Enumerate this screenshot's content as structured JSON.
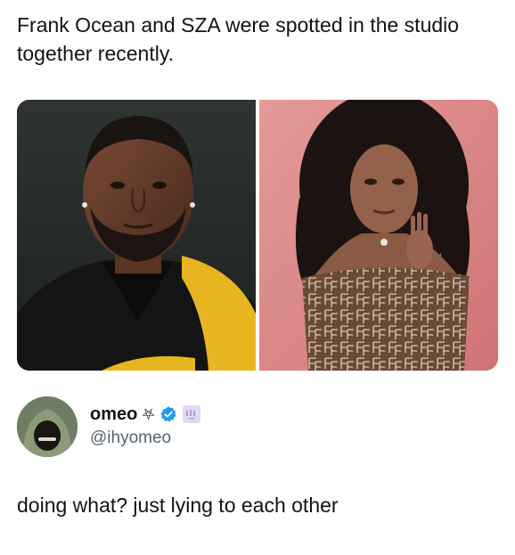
{
  "post": {
    "text": "Frank Ocean and SZA were spotted in the studio together recently."
  },
  "media": {
    "images": [
      {
        "icon": "photo-man-portrait"
      },
      {
        "icon": "photo-woman-portrait"
      }
    ]
  },
  "reply": {
    "author": {
      "display_name": "omeo",
      "name_symbol": "⛧",
      "handle": "@ihyomeo",
      "verified": true,
      "verified_color": "#1d9bf0",
      "badge_color": "#e3d9f3"
    },
    "text": "doing what? just lying to each other"
  },
  "colors": {
    "text": "#0f1419",
    "secondary_text": "#536471",
    "background": "#ffffff"
  }
}
